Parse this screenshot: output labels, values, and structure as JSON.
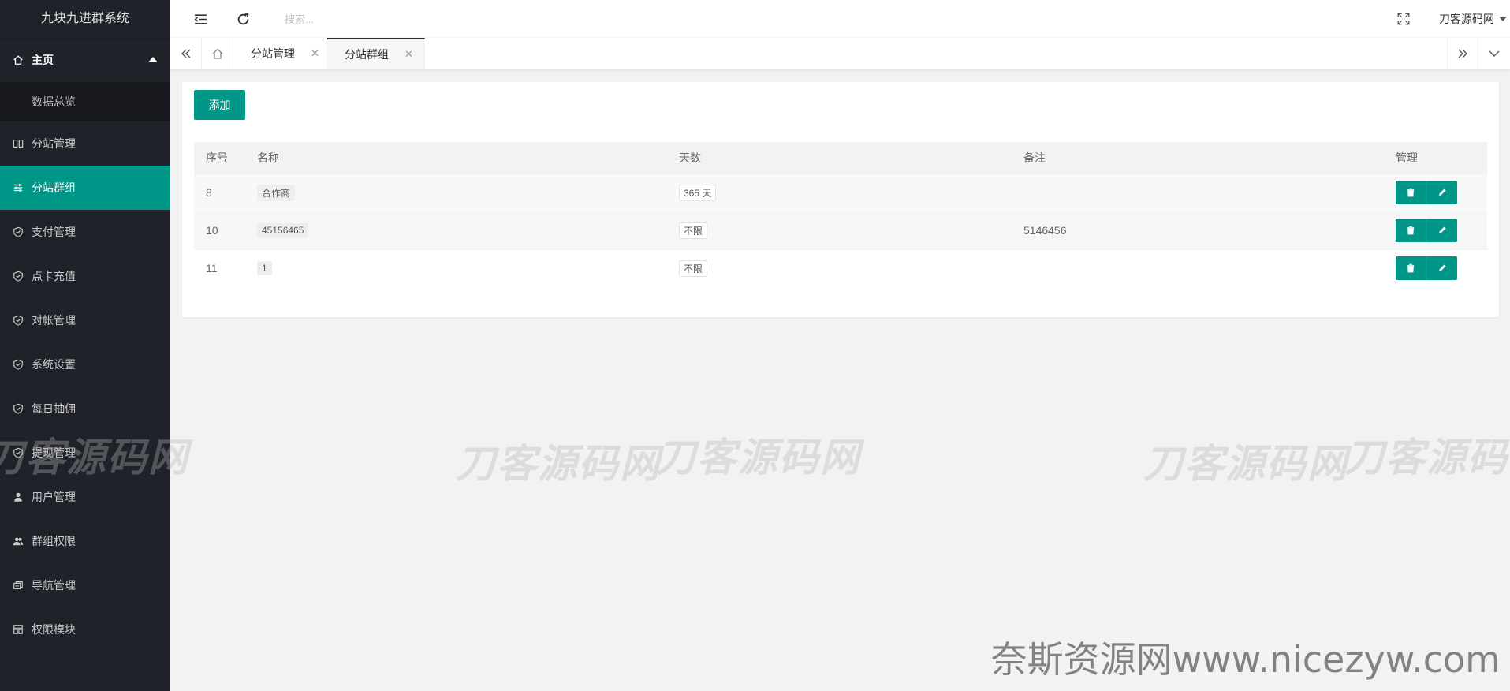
{
  "app": {
    "title": "九块九进群系统"
  },
  "sidebar": {
    "home": {
      "label": "主页",
      "icon": "home-icon"
    },
    "home_sub": [
      {
        "label": "数据总览"
      }
    ],
    "items": [
      {
        "label": "分站管理",
        "icon": "columns-icon"
      },
      {
        "label": "分站群组",
        "icon": "sliders-icon",
        "active": true
      },
      {
        "label": "支付管理",
        "icon": "shield-icon"
      },
      {
        "label": "点卡充值",
        "icon": "shield-icon"
      },
      {
        "label": "对帐管理",
        "icon": "shield-icon"
      },
      {
        "label": "系统设置",
        "icon": "shield-icon"
      },
      {
        "label": "每日抽佣",
        "icon": "shield-icon"
      },
      {
        "label": "提现管理",
        "icon": "shield-icon"
      },
      {
        "label": "用户管理",
        "icon": "user-icon"
      },
      {
        "label": "群组权限",
        "icon": "users-icon"
      },
      {
        "label": "导航管理",
        "icon": "nav-icon"
      },
      {
        "label": "权限模块",
        "icon": "grid-icon"
      }
    ]
  },
  "header": {
    "search_placeholder": "搜索...",
    "user_name": "刀客源码网"
  },
  "tabs": [
    {
      "label": "分站管理",
      "active": false
    },
    {
      "label": "分站群组",
      "active": true
    }
  ],
  "content": {
    "add_label": "添加",
    "table": {
      "headers": [
        "序号",
        "名称",
        "天数",
        "备注",
        "管理"
      ],
      "rows": [
        {
          "id": "8",
          "name": "合作商",
          "days": "365 天",
          "note": ""
        },
        {
          "id": "10",
          "name": "45156465",
          "days": "不限",
          "note": "5146456"
        },
        {
          "id": "11",
          "name": "1",
          "days": "不限",
          "note": ""
        }
      ]
    }
  },
  "watermarks": {
    "text": "刀客源码网",
    "site": "奈斯资源网www.nicezyw.com"
  },
  "colors": {
    "accent": "#009688",
    "sidebar_bg": "#20222a",
    "sidebar_sub_bg": "#17181d",
    "page_bg": "#f2f2f2"
  }
}
